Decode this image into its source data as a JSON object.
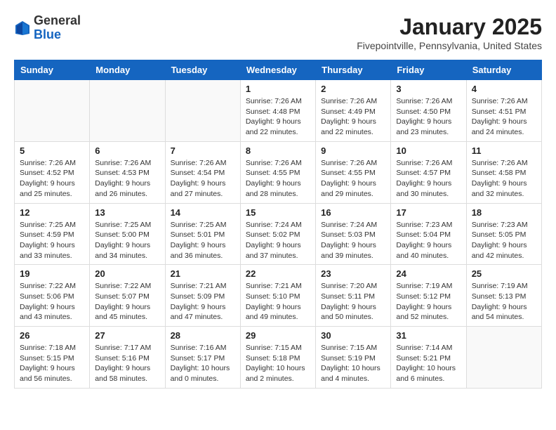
{
  "header": {
    "logo_general": "General",
    "logo_blue": "Blue",
    "month_title": "January 2025",
    "location": "Fivepointville, Pennsylvania, United States"
  },
  "days_of_week": [
    "Sunday",
    "Monday",
    "Tuesday",
    "Wednesday",
    "Thursday",
    "Friday",
    "Saturday"
  ],
  "weeks": [
    [
      {
        "day": "",
        "sunrise": "",
        "sunset": "",
        "daylight": ""
      },
      {
        "day": "",
        "sunrise": "",
        "sunset": "",
        "daylight": ""
      },
      {
        "day": "",
        "sunrise": "",
        "sunset": "",
        "daylight": ""
      },
      {
        "day": "1",
        "sunrise": "Sunrise: 7:26 AM",
        "sunset": "Sunset: 4:48 PM",
        "daylight": "Daylight: 9 hours and 22 minutes."
      },
      {
        "day": "2",
        "sunrise": "Sunrise: 7:26 AM",
        "sunset": "Sunset: 4:49 PM",
        "daylight": "Daylight: 9 hours and 22 minutes."
      },
      {
        "day": "3",
        "sunrise": "Sunrise: 7:26 AM",
        "sunset": "Sunset: 4:50 PM",
        "daylight": "Daylight: 9 hours and 23 minutes."
      },
      {
        "day": "4",
        "sunrise": "Sunrise: 7:26 AM",
        "sunset": "Sunset: 4:51 PM",
        "daylight": "Daylight: 9 hours and 24 minutes."
      }
    ],
    [
      {
        "day": "5",
        "sunrise": "Sunrise: 7:26 AM",
        "sunset": "Sunset: 4:52 PM",
        "daylight": "Daylight: 9 hours and 25 minutes."
      },
      {
        "day": "6",
        "sunrise": "Sunrise: 7:26 AM",
        "sunset": "Sunset: 4:53 PM",
        "daylight": "Daylight: 9 hours and 26 minutes."
      },
      {
        "day": "7",
        "sunrise": "Sunrise: 7:26 AM",
        "sunset": "Sunset: 4:54 PM",
        "daylight": "Daylight: 9 hours and 27 minutes."
      },
      {
        "day": "8",
        "sunrise": "Sunrise: 7:26 AM",
        "sunset": "Sunset: 4:55 PM",
        "daylight": "Daylight: 9 hours and 28 minutes."
      },
      {
        "day": "9",
        "sunrise": "Sunrise: 7:26 AM",
        "sunset": "Sunset: 4:55 PM",
        "daylight": "Daylight: 9 hours and 29 minutes."
      },
      {
        "day": "10",
        "sunrise": "Sunrise: 7:26 AM",
        "sunset": "Sunset: 4:57 PM",
        "daylight": "Daylight: 9 hours and 30 minutes."
      },
      {
        "day": "11",
        "sunrise": "Sunrise: 7:26 AM",
        "sunset": "Sunset: 4:58 PM",
        "daylight": "Daylight: 9 hours and 32 minutes."
      }
    ],
    [
      {
        "day": "12",
        "sunrise": "Sunrise: 7:25 AM",
        "sunset": "Sunset: 4:59 PM",
        "daylight": "Daylight: 9 hours and 33 minutes."
      },
      {
        "day": "13",
        "sunrise": "Sunrise: 7:25 AM",
        "sunset": "Sunset: 5:00 PM",
        "daylight": "Daylight: 9 hours and 34 minutes."
      },
      {
        "day": "14",
        "sunrise": "Sunrise: 7:25 AM",
        "sunset": "Sunset: 5:01 PM",
        "daylight": "Daylight: 9 hours and 36 minutes."
      },
      {
        "day": "15",
        "sunrise": "Sunrise: 7:24 AM",
        "sunset": "Sunset: 5:02 PM",
        "daylight": "Daylight: 9 hours and 37 minutes."
      },
      {
        "day": "16",
        "sunrise": "Sunrise: 7:24 AM",
        "sunset": "Sunset: 5:03 PM",
        "daylight": "Daylight: 9 hours and 39 minutes."
      },
      {
        "day": "17",
        "sunrise": "Sunrise: 7:23 AM",
        "sunset": "Sunset: 5:04 PM",
        "daylight": "Daylight: 9 hours and 40 minutes."
      },
      {
        "day": "18",
        "sunrise": "Sunrise: 7:23 AM",
        "sunset": "Sunset: 5:05 PM",
        "daylight": "Daylight: 9 hours and 42 minutes."
      }
    ],
    [
      {
        "day": "19",
        "sunrise": "Sunrise: 7:22 AM",
        "sunset": "Sunset: 5:06 PM",
        "daylight": "Daylight: 9 hours and 43 minutes."
      },
      {
        "day": "20",
        "sunrise": "Sunrise: 7:22 AM",
        "sunset": "Sunset: 5:07 PM",
        "daylight": "Daylight: 9 hours and 45 minutes."
      },
      {
        "day": "21",
        "sunrise": "Sunrise: 7:21 AM",
        "sunset": "Sunset: 5:09 PM",
        "daylight": "Daylight: 9 hours and 47 minutes."
      },
      {
        "day": "22",
        "sunrise": "Sunrise: 7:21 AM",
        "sunset": "Sunset: 5:10 PM",
        "daylight": "Daylight: 9 hours and 49 minutes."
      },
      {
        "day": "23",
        "sunrise": "Sunrise: 7:20 AM",
        "sunset": "Sunset: 5:11 PM",
        "daylight": "Daylight: 9 hours and 50 minutes."
      },
      {
        "day": "24",
        "sunrise": "Sunrise: 7:19 AM",
        "sunset": "Sunset: 5:12 PM",
        "daylight": "Daylight: 9 hours and 52 minutes."
      },
      {
        "day": "25",
        "sunrise": "Sunrise: 7:19 AM",
        "sunset": "Sunset: 5:13 PM",
        "daylight": "Daylight: 9 hours and 54 minutes."
      }
    ],
    [
      {
        "day": "26",
        "sunrise": "Sunrise: 7:18 AM",
        "sunset": "Sunset: 5:15 PM",
        "daylight": "Daylight: 9 hours and 56 minutes."
      },
      {
        "day": "27",
        "sunrise": "Sunrise: 7:17 AM",
        "sunset": "Sunset: 5:16 PM",
        "daylight": "Daylight: 9 hours and 58 minutes."
      },
      {
        "day": "28",
        "sunrise": "Sunrise: 7:16 AM",
        "sunset": "Sunset: 5:17 PM",
        "daylight": "Daylight: 10 hours and 0 minutes."
      },
      {
        "day": "29",
        "sunrise": "Sunrise: 7:15 AM",
        "sunset": "Sunset: 5:18 PM",
        "daylight": "Daylight: 10 hours and 2 minutes."
      },
      {
        "day": "30",
        "sunrise": "Sunrise: 7:15 AM",
        "sunset": "Sunset: 5:19 PM",
        "daylight": "Daylight: 10 hours and 4 minutes."
      },
      {
        "day": "31",
        "sunrise": "Sunrise: 7:14 AM",
        "sunset": "Sunset: 5:21 PM",
        "daylight": "Daylight: 10 hours and 6 minutes."
      },
      {
        "day": "",
        "sunrise": "",
        "sunset": "",
        "daylight": ""
      }
    ]
  ]
}
